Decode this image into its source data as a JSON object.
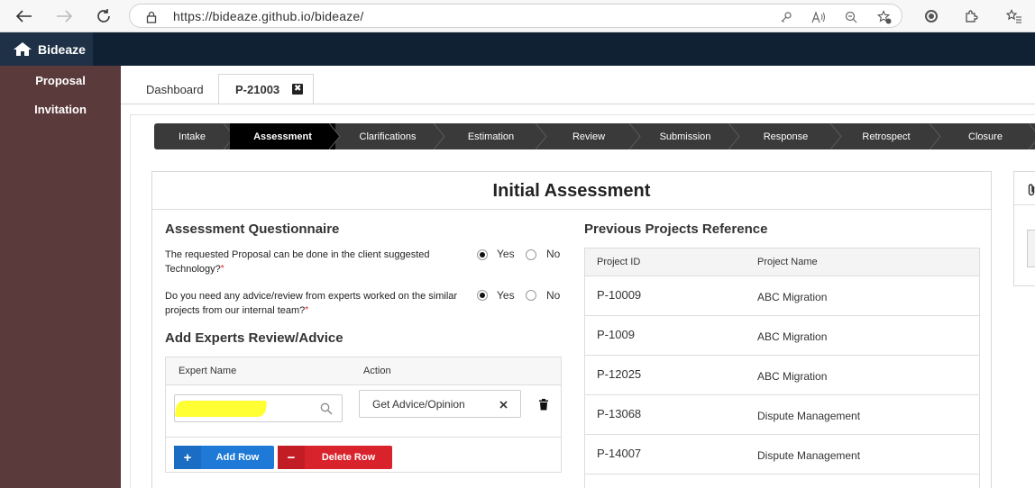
{
  "browser": {
    "url": "https://bideaze.github.io/bideaze/"
  },
  "app": {
    "brand": "Bideaze"
  },
  "sidebar": {
    "items": [
      {
        "label": "Proposal"
      },
      {
        "label": "Invitation"
      }
    ]
  },
  "tabs": [
    {
      "label": "Dashboard"
    },
    {
      "label": "P-21003",
      "close": "✖"
    }
  ],
  "stepper": {
    "steps": [
      "Intake",
      "Assessment",
      "Clarifications",
      "Estimation",
      "Review",
      "Submission",
      "Response",
      "Retrospect",
      "Closure"
    ],
    "active": "Assessment"
  },
  "card": {
    "title": "Initial Assessment"
  },
  "questionnaire": {
    "title": "Assessment Questionnaire",
    "questions": [
      {
        "text": "The requested Proposal can be done in the client suggested Technology?",
        "required": "*",
        "yes": "Yes",
        "no": "No",
        "selected": "Yes"
      },
      {
        "text": "Do you need any advice/review from experts worked on the similar projects from our internal team?",
        "required": "*",
        "yes": "Yes",
        "no": "No",
        "selected": "Yes"
      }
    ]
  },
  "experts": {
    "title": "Add Experts Review/Advice",
    "columns": [
      "Expert Name",
      "Action"
    ],
    "row": {
      "action": "Get Advice/Opinion"
    },
    "add_label": "Add Row",
    "delete_label": "Delete Row"
  },
  "projects": {
    "title": "Previous Projects Reference",
    "columns": [
      "Project ID",
      "Project Name"
    ],
    "rows": [
      {
        "id": "P-10009",
        "name": "ABC Migration"
      },
      {
        "id": "P-1009",
        "name": "ABC Migration"
      },
      {
        "id": "P-12025",
        "name": "ABC Migration"
      },
      {
        "id": "P-13068",
        "name": "Dispute Management"
      },
      {
        "id": "P-14007",
        "name": "Dispute Management"
      }
    ]
  }
}
